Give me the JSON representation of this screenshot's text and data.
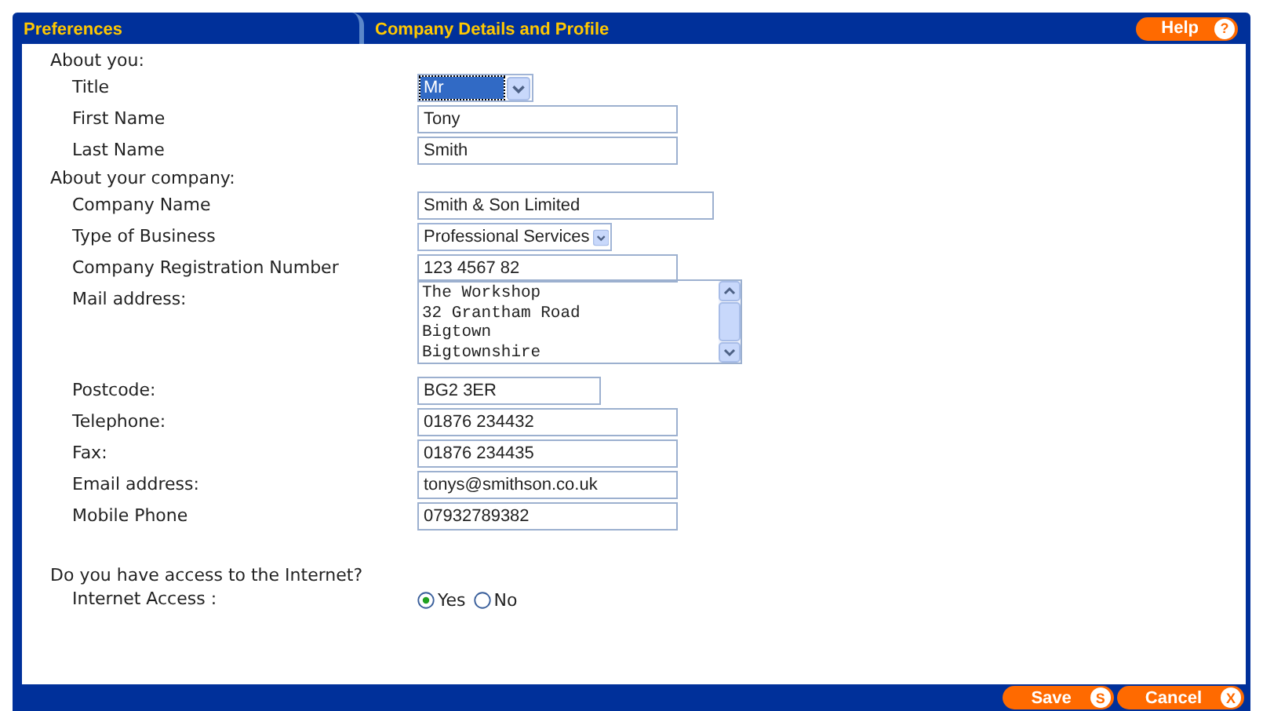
{
  "header": {
    "tabs": [
      {
        "label": "Preferences"
      },
      {
        "label": "Company Details and Profile"
      }
    ],
    "help": {
      "label": "Help",
      "key": "?"
    }
  },
  "sections": [
    {
      "heading": "About you:",
      "rows": [
        {
          "kind": "select",
          "label": "Title",
          "value": "Mr",
          "focused": true
        },
        {
          "kind": "text",
          "label": "First Name",
          "value": "Tony"
        },
        {
          "kind": "text",
          "label": "Last Name",
          "value": "Smith"
        }
      ]
    },
    {
      "heading": "About your company:",
      "rows": [
        {
          "kind": "text",
          "label": "Company Name",
          "value": "Smith & Son Limited"
        },
        {
          "kind": "select",
          "label": "Type of Business",
          "value": "Professional Services",
          "focused": false
        },
        {
          "kind": "text",
          "label": "Company Registration Number",
          "value": "123 4567 82"
        },
        {
          "kind": "textarea",
          "label": "Mail address:",
          "lines": [
            "The Workshop",
            "32 Grantham Road",
            "Bigtown",
            "Bigtownshire"
          ]
        },
        {
          "kind": "text",
          "label": "Postcode:",
          "value": "BG2 3ER"
        },
        {
          "kind": "text",
          "label": "Telephone:",
          "value": "01876 234432"
        },
        {
          "kind": "text",
          "label": "Fax:",
          "value": "01876 234435"
        },
        {
          "kind": "text",
          "label": "Email address:",
          "value": "tonys@smithson.co.uk"
        },
        {
          "kind": "text",
          "label": "Mobile Phone",
          "value": "07932789382"
        }
      ]
    },
    {
      "heading": "Do you have access to the Internet?",
      "rows": [
        {
          "kind": "radio",
          "label": "Internet Access :",
          "options": [
            {
              "label": "Yes",
              "selected": true
            },
            {
              "label": "No",
              "selected": false
            }
          ]
        }
      ]
    }
  ],
  "footer": {
    "buttons": [
      {
        "label": "Save",
        "key": "S"
      },
      {
        "label": "Cancel",
        "key": "X"
      }
    ]
  }
}
